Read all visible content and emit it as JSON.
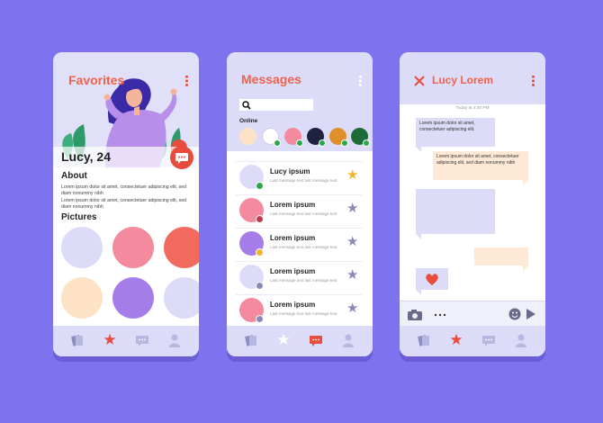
{
  "favorites": {
    "title": "Favorites",
    "profile_name": "Lucy, 24",
    "about_heading": "About",
    "about_text": [
      "Lorem ipsum dolor sit amet, consectetuer adipiscing elit, sed diam nonummy nibh",
      "Lorem ipsum dolor sit amet, consectetuer adipiscing elit, sed diam nonummy nibh"
    ],
    "pictures_heading": "Pictures",
    "picture_colors": [
      "#dcdcf8",
      "#f48a9e",
      "#f26a5e",
      "#fde2c6",
      "#a57de8",
      "#dcdcf8"
    ]
  },
  "messages": {
    "title": "Messages",
    "online_label": "Online",
    "online_colors": [
      "#fde2c6",
      "#ffffff",
      "#f48a9e",
      "#1e2140",
      "#e0902a",
      "#1c6b38"
    ],
    "conversations": [
      {
        "name": "Lucy ipsum",
        "preview": "Last message text last message text",
        "avatar_color": "#dcdcf8",
        "status_color": "#2aa84a",
        "starred": true
      },
      {
        "name": "Lorem ipsum",
        "preview": "Last message text last message text",
        "avatar_color": "#f48a9e",
        "status_color": "#c0394b",
        "starred": false
      },
      {
        "name": "Lorem ipsum",
        "preview": "Last message text last message text",
        "avatar_color": "#a57de8",
        "status_color": "#f3b62a",
        "starred": false
      },
      {
        "name": "Lorem ipsum",
        "preview": "Last message text last message text",
        "avatar_color": "#dcdcf8",
        "status_color": "#8a8ab8",
        "starred": false
      },
      {
        "name": "Lorem ipsum",
        "preview": "Last message text last message text",
        "avatar_color": "#f48a9e",
        "status_color": "#8a8ab8",
        "starred": false
      }
    ]
  },
  "chat": {
    "title": "Lucy Lorem",
    "date_label": "Today at 4:30 PM",
    "msg1": "Lorem ipsum dolor sit amet, consectetuer adipiscing elit.",
    "msg2": "Lorem ipsum dolor sit amet, consectetuer adipiscing elit, sed diam nonummy nibh"
  },
  "colors": {
    "background": "#7e72ee",
    "accent": "#e74c3c",
    "title": "#f0624a",
    "panel": "#dcdcf8"
  }
}
